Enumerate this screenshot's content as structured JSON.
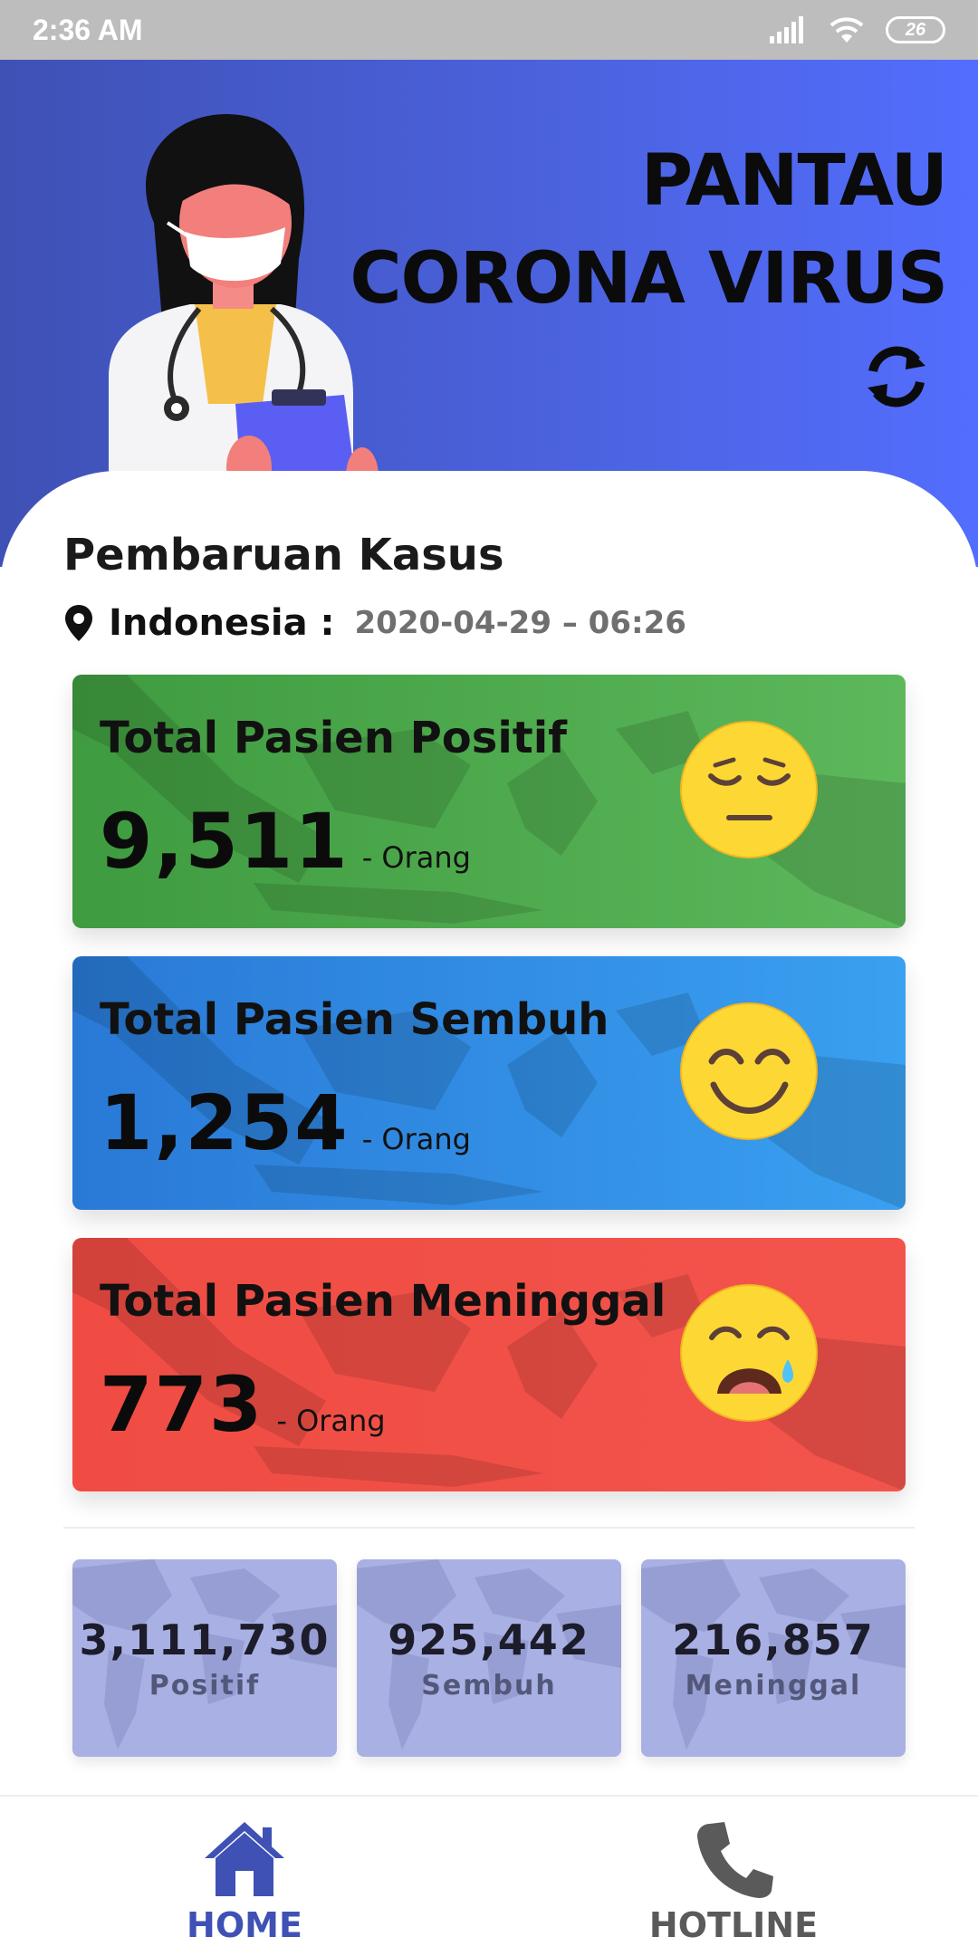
{
  "status_bar": {
    "time": "2:36 AM",
    "battery": "26"
  },
  "header": {
    "title_line1": "PANTAU",
    "title_line2": "CORONA VIRUS"
  },
  "section": {
    "title": "Pembaruan Kasus",
    "country": "Indonesia :",
    "updated": "2020-04-29 – 06:26"
  },
  "cards": [
    {
      "title": "Total Pasien Positif",
      "value": "9,511",
      "unit": "- Orang",
      "emoji": "pensive-face-icon",
      "color": "#4caf50"
    },
    {
      "title": "Total Pasien Sembuh",
      "value": "1,254",
      "unit": "- Orang",
      "emoji": "smiling-face-icon",
      "color": "#2196f3"
    },
    {
      "title": "Total Pasien Meninggal",
      "value": "773",
      "unit": "- Orang",
      "emoji": "crying-face-icon",
      "color": "#f44336"
    }
  ],
  "global": [
    {
      "value": "3,111,730",
      "label": "Positif"
    },
    {
      "value": "925,442",
      "label": "Sembuh"
    },
    {
      "value": "216,857",
      "label": "Meninggal"
    }
  ],
  "nav": {
    "home": "HOME",
    "hotline": "HOTLINE"
  },
  "colors": {
    "accent": "#3f51b5",
    "header_start": "#3f51b5",
    "header_end": "#536dfe"
  }
}
